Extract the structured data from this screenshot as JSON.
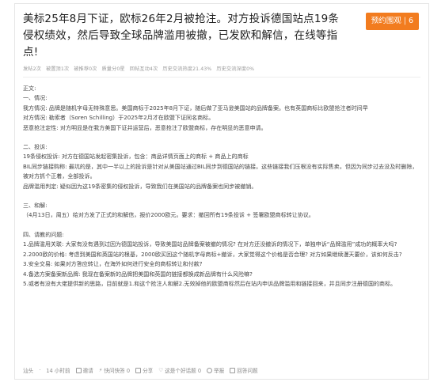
{
  "post": {
    "title": "美标25年8月下证，欧标26年2月被抢注。对方投诉德国站点19条侵权绩效，然后导致全球品牌滥用被撤，已发欧和解信，在线等指点!",
    "vote_label": "预约围观",
    "vote_count": "6",
    "stats": [
      "发帖2次",
      "被置顶1次",
      "被推荐0次",
      "质量分0星",
      "回帖互动4次",
      "历史交流热度21.43%",
      "历史交流深度0%"
    ]
  },
  "body": {
    "lines": [
      "正文:",
      "一、情况:",
      "我方情况:   品牌是随机字母无特殊意思。美国商标于2025年8月下证，随后做了亚马逊美国站的品牌备案。也有英国商标比欧盟抢注者时间早",
      "对方情况:   勒索者（Soren Schilling）于2025年2月才在欧盟下证同名商标。",
      "恶意抢注定性:   对方明显是在我方美国下证并运营后，恶意抢注了欧盟商标，存在明显的恶意申请。",
      "",
      "二、投诉:",
      "19条侵权投诉:   对方在德国站发起密集投诉，包含：商品详情页面上的商标 + 商品上的商标",
      "BIL同步链接购称:   最坑的是，其中一半以上的投诉是针对从美国站通过BIL同步到德国站的链接。这些链接我们压根没有实际售卖，但因为同步过去没及时删除，被对方抓个正着，全部投诉。",
      "品牌滥用判定:   疑似因为这19条密集的侵权投诉，导致我们在美国站的品牌备案也同步被撤销。",
      "",
      "三、和解:",
      "（4月13日，周五）给对方发了正式的和解信，报价2000欧元。要求：撤回所有19条投诉 + 签署欧盟商标转让协议。",
      "",
      "四、请教的问题:",
      "1.品牌滥用关联:   大家有没有遇到过因为德国站投诉，导致美国站品牌备案被撤的情况? 在对方还没撤诉的情况下，单独申诉“品牌滥用”成功的概率大吗?",
      "2.2000欧的价格:   考虑到美国和英国站的根基，2000欧买回这个随机字母商标+撤诉，大家觉得这个价格是否合理? 对方如果继续漫天要价，该如何反击?",
      "3.安全交易:   如果对方答应转让，在海外如何进行安全的商标转让和付款?",
      "4.备选方案备案新品牌:   我现在备案新的品牌把美国和英国的链接都换成新品牌有什么风险嘛?",
      "5.或者有没有大佬提供新的思路，目前就是1.和这个抢注人和解2.无效掉他的欧盟商标然后在站内申诉品牌滥用和链接回来，并且同步注册德国的商标。"
    ]
  },
  "footer": {
    "author": "汕头",
    "time": "14 小时前",
    "invite": "邀请",
    "quick_reply": "快问快答 0",
    "share": "分享",
    "good_question": "这是个好话题 0",
    "report": "举报",
    "similar": "回答问题",
    "dot": "·"
  }
}
